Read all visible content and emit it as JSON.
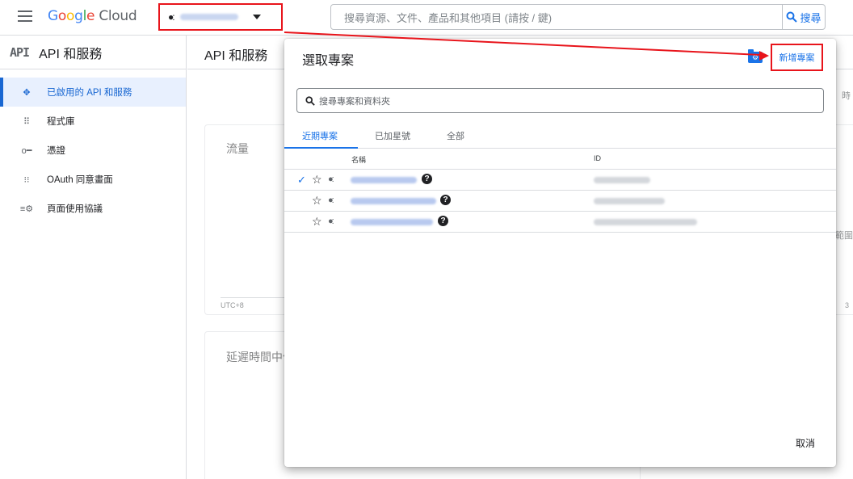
{
  "topbar": {
    "logo_google": [
      "G",
      "o",
      "o",
      "g",
      "l",
      "e"
    ],
    "logo_cloud": "Cloud",
    "search_placeholder": "搜尋資源、文件、產品和其他項目 (請按 / 鍵)",
    "search_button": "搜尋"
  },
  "sidenav": {
    "product_icon": "API",
    "title": "API 和服務",
    "items": [
      {
        "label": "已啟用的 API 和服務",
        "icon": "diamond-dots-icon",
        "glyph": "✥"
      },
      {
        "label": "程式庫",
        "icon": "library-icon",
        "glyph": "⠿"
      },
      {
        "label": "憑證",
        "icon": "key-icon",
        "glyph": "o━"
      },
      {
        "label": "OAuth 同意畫面",
        "icon": "consent-icon",
        "glyph": "⁝⁝"
      },
      {
        "label": "頁面使用協議",
        "icon": "settings-list-icon",
        "glyph": "≡⚙"
      }
    ]
  },
  "background": {
    "title": "API 和服務",
    "card1_title": "流量",
    "card2_title": "延遲時間中位",
    "utc": "UTC+8",
    "peek_right_top": "時",
    "peek_right_mid": "範圍",
    "peek_right_bottom": "3"
  },
  "dialog": {
    "title": "選取專案",
    "new_project": "新增專案",
    "search_placeholder": "搜尋專案和資料夾",
    "tabs": [
      "近期專案",
      "已加星號",
      "全部"
    ],
    "columns": {
      "name": "名稱",
      "id": "ID"
    },
    "rows": [
      {
        "checked": true
      },
      {
        "checked": false
      },
      {
        "checked": false
      }
    ],
    "cancel": "取消"
  },
  "colors": {
    "accent": "#1a73e8",
    "highlight_red": "#e8141b",
    "active_nav_bg": "#e8f0fe"
  }
}
